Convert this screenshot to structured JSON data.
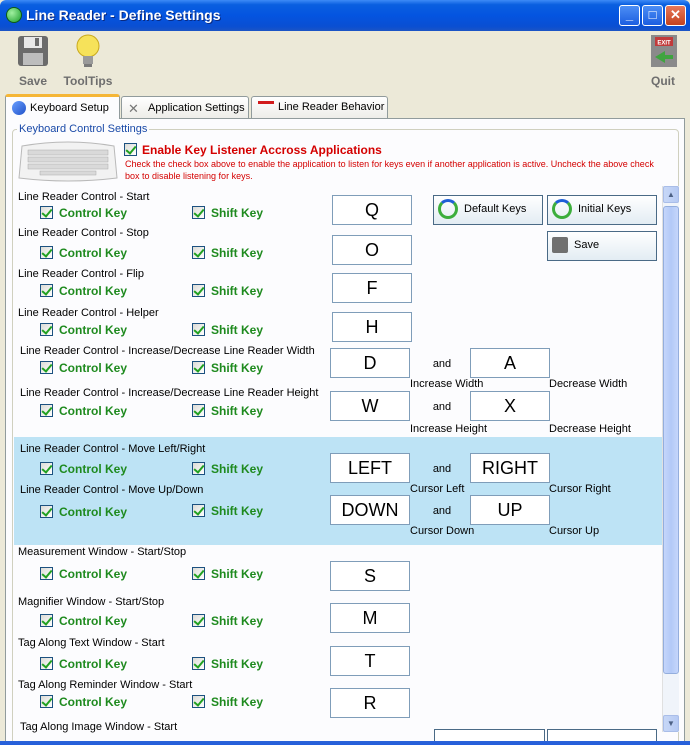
{
  "window": {
    "title": "Line Reader - Define Settings"
  },
  "toolbar": {
    "save_label": "Save",
    "tooltips_label": "ToolTips",
    "quit_label": "Quit",
    "exit_badge": "EXIT"
  },
  "tabs": [
    {
      "label": "Keyboard Setup"
    },
    {
      "label": "Application Settings"
    },
    {
      "label": "Line Reader Behavior"
    }
  ],
  "group": {
    "title": "Keyboard Control Settings",
    "enable_label": "Enable Key Listener Accross Applications",
    "enable_help": "Check the check box above to enable the application to listen for keys even if another application is active.  Uncheck the above check box to disable listening for keys."
  },
  "common": {
    "control_key": "Control Key",
    "shift_key": "Shift Key",
    "and": "and"
  },
  "buttons": {
    "default_keys": "Default Keys",
    "initial_keys": "Initial Keys",
    "save": "Save"
  },
  "rows": {
    "start": {
      "label": "Line Reader Control - Start",
      "key": "Q"
    },
    "stop": {
      "label": "Line Reader Control - Stop",
      "key": "O"
    },
    "flip": {
      "label": "Line Reader Control - Flip",
      "key": "F"
    },
    "helper": {
      "label": "Line Reader Control - Helper",
      "key": "H"
    },
    "width": {
      "label": "Line Reader Control - Increase/Decrease Line Reader Width",
      "key1": "D",
      "key2": "A",
      "sub1": "Increase Width",
      "sub2": "Decrease Width"
    },
    "height": {
      "label": "Line Reader Control - Increase/Decrease Line Reader Height",
      "key1": "W",
      "key2": "X",
      "sub1": "Increase Height",
      "sub2": "Decrease Height"
    },
    "leftright": {
      "label": "Line Reader Control - Move Left/Right",
      "key1": "LEFT",
      "key2": "RIGHT",
      "sub1": "Cursor Left",
      "sub2": "Cursor Right"
    },
    "updown": {
      "label": "Line Reader Control - Move Up/Down",
      "key1": "DOWN",
      "key2": "UP",
      "sub1": "Cursor Down",
      "sub2": "Cursor Up"
    },
    "measurement": {
      "label": "Measurement Window - Start/Stop",
      "key": "S"
    },
    "magnifier": {
      "label": "Magnifier Window - Start/Stop",
      "key": "M"
    },
    "tag_text": {
      "label": "Tag Along Text Window - Start",
      "key": "T"
    },
    "tag_reminder": {
      "label": "Tag Along Reminder Window - Start",
      "key": "R"
    },
    "tag_image": {
      "label": "Tag Along Image Window - Start"
    }
  }
}
